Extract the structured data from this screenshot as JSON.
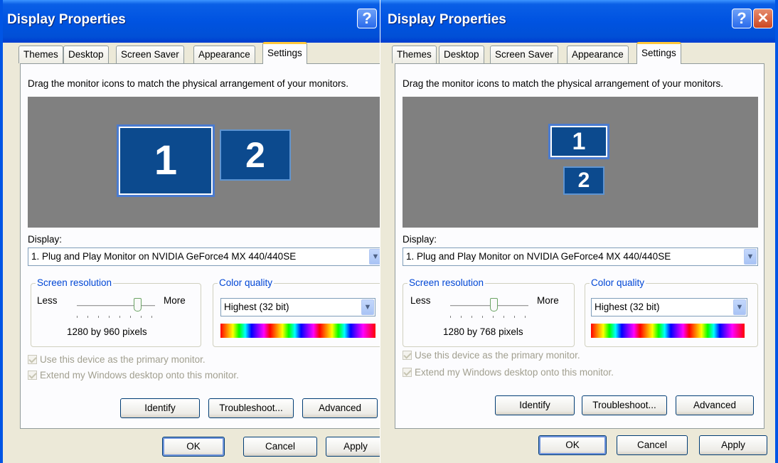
{
  "windows": [
    {
      "title": "Display Properties",
      "help_label": "?",
      "close_label": "",
      "tabs": [
        "Themes",
        "Desktop",
        "Screen Saver",
        "Appearance",
        "Settings"
      ],
      "active_tab": "Settings",
      "instruction": "Drag the monitor icons to match the physical arrangement of your monitors.",
      "monitors": [
        {
          "label": "1",
          "selected": true
        },
        {
          "label": "2",
          "selected": false
        }
      ],
      "display_label": "Display:",
      "display_value": "1. Plug and Play Monitor on NVIDIA GeForce4 MX 440/440SE",
      "resolution": {
        "title": "Screen resolution",
        "less": "Less",
        "more": "More",
        "value": "1280 by 960 pixels",
        "slider_fraction": 0.78
      },
      "color_quality": {
        "title": "Color quality",
        "value": "Highest (32 bit)"
      },
      "checkboxes": [
        "Use this device as the primary monitor.",
        "Extend my Windows desktop onto this monitor."
      ],
      "buttons": {
        "identify": "Identify",
        "troubleshoot": "Troubleshoot...",
        "advanced": "Advanced",
        "ok": "OK",
        "cancel": "Cancel",
        "apply": "Apply"
      }
    },
    {
      "title": "Display Properties",
      "help_label": "?",
      "close_label": "✕",
      "tabs": [
        "Themes",
        "Desktop",
        "Screen Saver",
        "Appearance",
        "Settings"
      ],
      "active_tab": "Settings",
      "instruction": "Drag the monitor icons to match the physical arrangement of your monitors.",
      "monitors": [
        {
          "label": "1",
          "selected": true
        },
        {
          "label": "2",
          "selected": false
        }
      ],
      "display_label": "Display:",
      "display_value": "1. Plug and Play Monitor on NVIDIA GeForce4 MX 440/440SE",
      "resolution": {
        "title": "Screen resolution",
        "less": "Less",
        "more": "More",
        "value": "1280 by 768 pixels",
        "slider_fraction": 0.56
      },
      "color_quality": {
        "title": "Color quality",
        "value": "Highest (32 bit)"
      },
      "checkboxes": [
        "Use this device as the primary monitor.",
        "Extend my Windows desktop onto this monitor."
      ],
      "buttons": {
        "identify": "Identify",
        "troubleshoot": "Troubleshoot...",
        "advanced": "Advanced",
        "ok": "OK",
        "cancel": "Cancel",
        "apply": "Apply"
      }
    }
  ]
}
